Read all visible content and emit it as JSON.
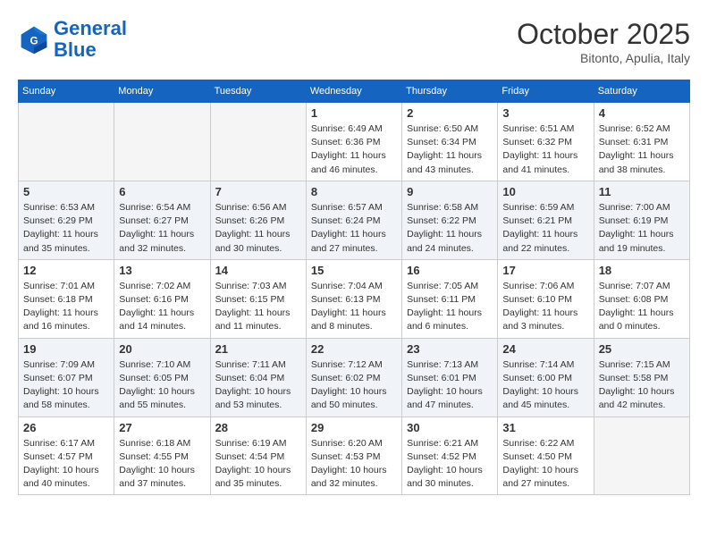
{
  "header": {
    "logo_line1": "General",
    "logo_line2": "Blue",
    "month": "October 2025",
    "location": "Bitonto, Apulia, Italy"
  },
  "weekdays": [
    "Sunday",
    "Monday",
    "Tuesday",
    "Wednesday",
    "Thursday",
    "Friday",
    "Saturday"
  ],
  "weeks": [
    [
      {
        "day": "",
        "info": ""
      },
      {
        "day": "",
        "info": ""
      },
      {
        "day": "",
        "info": ""
      },
      {
        "day": "1",
        "info": "Sunrise: 6:49 AM\nSunset: 6:36 PM\nDaylight: 11 hours\nand 46 minutes."
      },
      {
        "day": "2",
        "info": "Sunrise: 6:50 AM\nSunset: 6:34 PM\nDaylight: 11 hours\nand 43 minutes."
      },
      {
        "day": "3",
        "info": "Sunrise: 6:51 AM\nSunset: 6:32 PM\nDaylight: 11 hours\nand 41 minutes."
      },
      {
        "day": "4",
        "info": "Sunrise: 6:52 AM\nSunset: 6:31 PM\nDaylight: 11 hours\nand 38 minutes."
      }
    ],
    [
      {
        "day": "5",
        "info": "Sunrise: 6:53 AM\nSunset: 6:29 PM\nDaylight: 11 hours\nand 35 minutes."
      },
      {
        "day": "6",
        "info": "Sunrise: 6:54 AM\nSunset: 6:27 PM\nDaylight: 11 hours\nand 32 minutes."
      },
      {
        "day": "7",
        "info": "Sunrise: 6:56 AM\nSunset: 6:26 PM\nDaylight: 11 hours\nand 30 minutes."
      },
      {
        "day": "8",
        "info": "Sunrise: 6:57 AM\nSunset: 6:24 PM\nDaylight: 11 hours\nand 27 minutes."
      },
      {
        "day": "9",
        "info": "Sunrise: 6:58 AM\nSunset: 6:22 PM\nDaylight: 11 hours\nand 24 minutes."
      },
      {
        "day": "10",
        "info": "Sunrise: 6:59 AM\nSunset: 6:21 PM\nDaylight: 11 hours\nand 22 minutes."
      },
      {
        "day": "11",
        "info": "Sunrise: 7:00 AM\nSunset: 6:19 PM\nDaylight: 11 hours\nand 19 minutes."
      }
    ],
    [
      {
        "day": "12",
        "info": "Sunrise: 7:01 AM\nSunset: 6:18 PM\nDaylight: 11 hours\nand 16 minutes."
      },
      {
        "day": "13",
        "info": "Sunrise: 7:02 AM\nSunset: 6:16 PM\nDaylight: 11 hours\nand 14 minutes."
      },
      {
        "day": "14",
        "info": "Sunrise: 7:03 AM\nSunset: 6:15 PM\nDaylight: 11 hours\nand 11 minutes."
      },
      {
        "day": "15",
        "info": "Sunrise: 7:04 AM\nSunset: 6:13 PM\nDaylight: 11 hours\nand 8 minutes."
      },
      {
        "day": "16",
        "info": "Sunrise: 7:05 AM\nSunset: 6:11 PM\nDaylight: 11 hours\nand 6 minutes."
      },
      {
        "day": "17",
        "info": "Sunrise: 7:06 AM\nSunset: 6:10 PM\nDaylight: 11 hours\nand 3 minutes."
      },
      {
        "day": "18",
        "info": "Sunrise: 7:07 AM\nSunset: 6:08 PM\nDaylight: 11 hours\nand 0 minutes."
      }
    ],
    [
      {
        "day": "19",
        "info": "Sunrise: 7:09 AM\nSunset: 6:07 PM\nDaylight: 10 hours\nand 58 minutes."
      },
      {
        "day": "20",
        "info": "Sunrise: 7:10 AM\nSunset: 6:05 PM\nDaylight: 10 hours\nand 55 minutes."
      },
      {
        "day": "21",
        "info": "Sunrise: 7:11 AM\nSunset: 6:04 PM\nDaylight: 10 hours\nand 53 minutes."
      },
      {
        "day": "22",
        "info": "Sunrise: 7:12 AM\nSunset: 6:02 PM\nDaylight: 10 hours\nand 50 minutes."
      },
      {
        "day": "23",
        "info": "Sunrise: 7:13 AM\nSunset: 6:01 PM\nDaylight: 10 hours\nand 47 minutes."
      },
      {
        "day": "24",
        "info": "Sunrise: 7:14 AM\nSunset: 6:00 PM\nDaylight: 10 hours\nand 45 minutes."
      },
      {
        "day": "25",
        "info": "Sunrise: 7:15 AM\nSunset: 5:58 PM\nDaylight: 10 hours\nand 42 minutes."
      }
    ],
    [
      {
        "day": "26",
        "info": "Sunrise: 6:17 AM\nSunset: 4:57 PM\nDaylight: 10 hours\nand 40 minutes."
      },
      {
        "day": "27",
        "info": "Sunrise: 6:18 AM\nSunset: 4:55 PM\nDaylight: 10 hours\nand 37 minutes."
      },
      {
        "day": "28",
        "info": "Sunrise: 6:19 AM\nSunset: 4:54 PM\nDaylight: 10 hours\nand 35 minutes."
      },
      {
        "day": "29",
        "info": "Sunrise: 6:20 AM\nSunset: 4:53 PM\nDaylight: 10 hours\nand 32 minutes."
      },
      {
        "day": "30",
        "info": "Sunrise: 6:21 AM\nSunset: 4:52 PM\nDaylight: 10 hours\nand 30 minutes."
      },
      {
        "day": "31",
        "info": "Sunrise: 6:22 AM\nSunset: 4:50 PM\nDaylight: 10 hours\nand 27 minutes."
      },
      {
        "day": "",
        "info": ""
      }
    ]
  ]
}
